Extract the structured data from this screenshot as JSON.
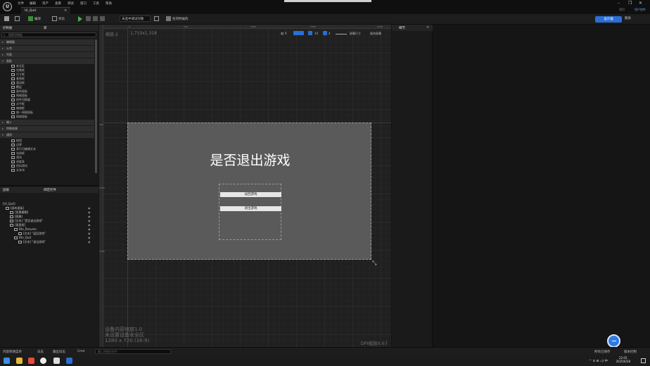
{
  "titlebar": {
    "menu": [
      "文件",
      "编辑",
      "资产",
      "查看",
      "调试",
      "窗口",
      "工具",
      "帮助"
    ],
    "tab_label": "UI_Quit",
    "tab_close": "×",
    "project_name": "项目",
    "mode_name": "用户控件",
    "win_min": "–",
    "win_max": "❐",
    "win_close": "✕"
  },
  "toolbar": {
    "compile_label": "编译",
    "diff_label": "对比",
    "debug_filter": "未选中调试对象",
    "record_label": "任何时候的",
    "designer_label": "设计器",
    "graph_label": "图表"
  },
  "palette": {
    "tab_palette": "控制板",
    "tab_library": "库",
    "search_placeholder": "搜索控制板",
    "categories_top": [
      "编辑器",
      "公共",
      "列表",
      "面板"
    ],
    "panel_items": [
      "安全区",
      "包装框",
      "尺寸框",
      "垂直框",
      "滚动框",
      "覆层",
      "画布面板",
      "网格面板",
      "控件切换器",
      "水平框",
      "缩放框",
      "统一网格面板",
      "网络面板"
    ],
    "categories_mid": [
      "输入",
      "特殊效果",
      "通用"
    ],
    "common_items": [
      "按钮",
      "边界",
      "多行可编辑文本",
      "勾选框",
      "滑块",
      "进度条",
      "径向滑块",
      "文本块"
    ]
  },
  "hierarchy": {
    "tab_hierarchy": "层级",
    "tab_bindings": "绑定控件",
    "rows": [
      "[UI_Quit]",
      "[画布面板]",
      "[背景模糊]",
      "[图像]",
      "[文本] \"是否退出游戏\"",
      "[垂直框]",
      "Btn_Resume",
      "[文本] \"返回游戏\"",
      "Btn_Quit",
      "[文本] \"退出游戏\""
    ]
  },
  "viewport": {
    "zoom": "缩放-2",
    "dims": "1,710x1,318",
    "ruler_top": [
      "0",
      "500",
      "1000",
      "1500",
      "2000"
    ],
    "ruler_left": [
      "500",
      "1000",
      "1500"
    ],
    "screen_size_label": "屏幕尺寸",
    "fill_label": "填充屏幕",
    "title_text": "是否退出游戏",
    "resume_button": "返回游戏",
    "quit_button": "退出游戏",
    "footnote_1": "设备内容缩放1.0",
    "footnote_2": "未设置设备安全区",
    "footnote_3": "1280 x 720 (16:9)",
    "dpi": "DPI缩放0.67",
    "resize_icon": "⤡",
    "tb_r": "R",
    "tb_10": "10",
    "tb_4": "4"
  },
  "details": {
    "tab_details": "细节"
  },
  "bottombar": {
    "content_drawer": "内容侧滑菜单",
    "output_log": "输出日志",
    "cmd_label": "Cmd",
    "cmd_placeholder": "输入控制台命令",
    "source_control": "所有已保存",
    "revision": "版本控制",
    "log_label": "日志"
  },
  "taskbar": {
    "time": "22:05",
    "date": "2025/6/28",
    "tray_text": "^ ⊡ ⊞ ◁) 中"
  },
  "colors": {
    "accent": "#2a6fd6",
    "canvas": "#5a5a5a",
    "button_bg": "#e6e6e6"
  }
}
